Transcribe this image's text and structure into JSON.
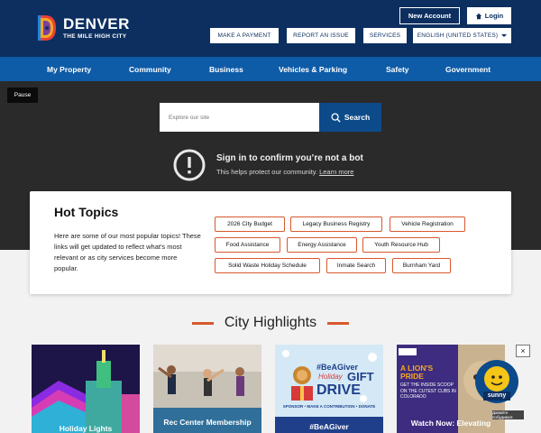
{
  "header": {
    "logo_title": "DENVER",
    "logo_subtitle": "THE MILE HIGH CITY",
    "new_account": "New Account",
    "login": "Login",
    "utility_links": [
      "MAKE A PAYMENT",
      "REPORT AN ISSUE",
      "SERVICES"
    ],
    "language": "ENGLISH (UNITED STATES)",
    "colors": {
      "brand_navy": "#0d2f60",
      "nav_blue": "#0e5ba7",
      "accent_orange": "#d7592e"
    }
  },
  "nav": {
    "items": [
      "My Property",
      "Community",
      "Business",
      "Vehicles & Parking",
      "Safety",
      "Government"
    ]
  },
  "hero": {
    "pause_label": "Pause",
    "search_placeholder": "Explore our site",
    "search_button": "Search",
    "bot_title": "Sign in to confirm you’re not a bot",
    "bot_sub": "This helps protect our community.",
    "bot_link": "Learn more"
  },
  "hot_topics": {
    "title": "Hot Topics",
    "description": "Here are some of our most popular topics! These links will get updated to reflect what's most relevant or as city services become more popular.",
    "chips": [
      "2026 City Budget",
      "Legacy Business Registry",
      "Vehicle Registration",
      "Food Assistance",
      "Energy Assistance",
      "Youth Resource Hub",
      "Solid Waste Holiday Schedule",
      "Inmate Search",
      "Burnham Yard"
    ]
  },
  "highlights": {
    "title": "City Highlights",
    "tiles": [
      {
        "label": "Holiday Lights"
      },
      {
        "label": "Rec Center Membership"
      },
      {
        "label": "#BeAGiver",
        "tag1": "#BeAGiver",
        "tag2": "Holiday",
        "tag3": "GIFT",
        "tag4": "DRIVE",
        "footer": "SPONSOR • MAKE A CONTRIBUTION • DONATE"
      },
      {
        "label": "Watch Now: Elevating",
        "headline": "A LION'S PRIDE",
        "sub": "GET THE INSIDE SCOOP ON THE CUTEST CUBS IN COLORADO"
      }
    ],
    "weather": {
      "condition": "sunny",
      "tooltip": "Давайте побудимся"
    },
    "close": "×"
  }
}
